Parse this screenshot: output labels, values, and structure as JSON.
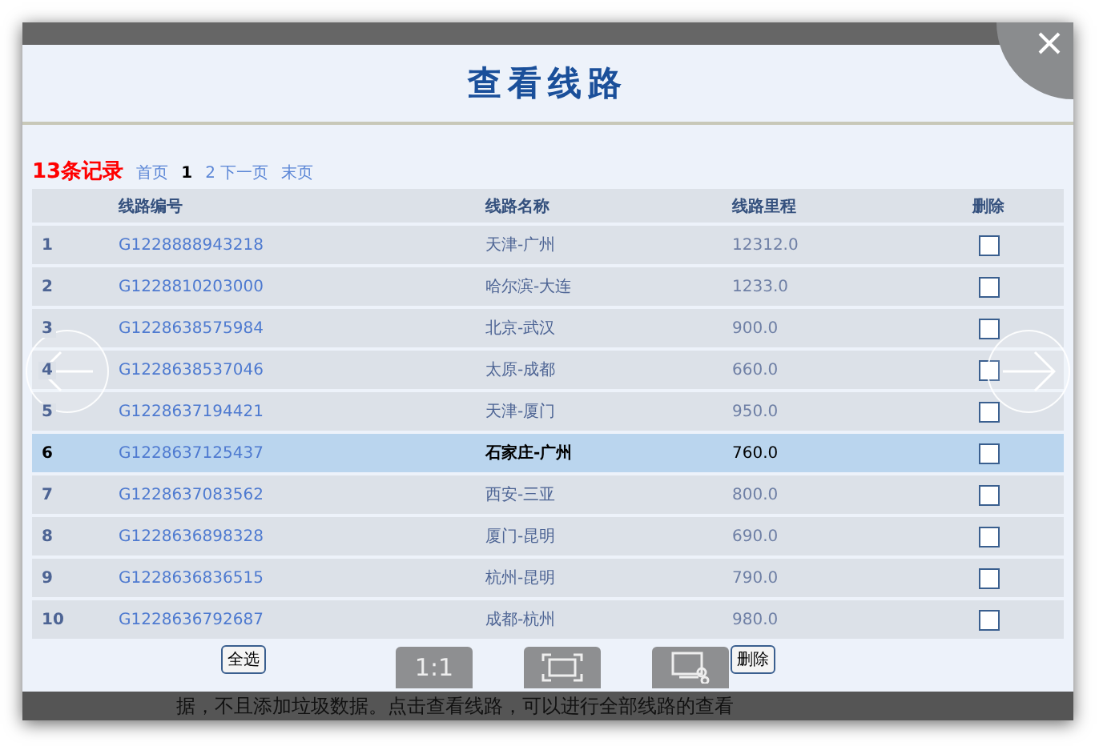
{
  "title": "查看线路",
  "pager": {
    "count": "13条记录",
    "first": "首页",
    "current": "1",
    "next": "2 下一页",
    "last": "末页"
  },
  "columns": [
    "线路编号",
    "线路名称",
    "线路里程",
    "删除"
  ],
  "rows": [
    {
      "index": "1",
      "code": "G1228888943218",
      "name": "天津-广州",
      "distance": "12312.0",
      "selected": false,
      "checked": false
    },
    {
      "index": "2",
      "code": "G1228810203000",
      "name": "哈尔滨-大连",
      "distance": "1233.0",
      "selected": false,
      "checked": false
    },
    {
      "index": "3",
      "code": "G1228638575984",
      "name": "北京-武汉",
      "distance": "900.0",
      "selected": false,
      "checked": false
    },
    {
      "index": "4",
      "code": "G1228638537046",
      "name": "太原-成都",
      "distance": "660.0",
      "selected": false,
      "checked": false
    },
    {
      "index": "5",
      "code": "G1228637194421",
      "name": "天津-厦门",
      "distance": "950.0",
      "selected": false,
      "checked": false
    },
    {
      "index": "6",
      "code": "G1228637125437",
      "name": "石家庄-广州",
      "distance": "760.0",
      "selected": true,
      "checked": false
    },
    {
      "index": "7",
      "code": "G1228637083562",
      "name": "西安-三亚",
      "distance": "800.0",
      "selected": false,
      "checked": false
    },
    {
      "index": "8",
      "code": "G1228636898328",
      "name": "厦门-昆明",
      "distance": "690.0",
      "selected": false,
      "checked": false
    },
    {
      "index": "9",
      "code": "G1228636836515",
      "name": "杭州-昆明",
      "distance": "790.0",
      "selected": false,
      "checked": false
    },
    {
      "index": "10",
      "code": "G1228636792687",
      "name": "成都-杭州",
      "distance": "980.0",
      "selected": false,
      "checked": false
    }
  ],
  "select_all": "全选",
  "delete": "删除",
  "viewer_toolbar": [
    {
      "kind": "text",
      "label": "1:1"
    },
    {
      "kind": "fit"
    },
    {
      "kind": "crop"
    }
  ],
  "footer_text": "据，不且添加垃圾数据。点击查看线路，可以进行全部线路的查看"
}
